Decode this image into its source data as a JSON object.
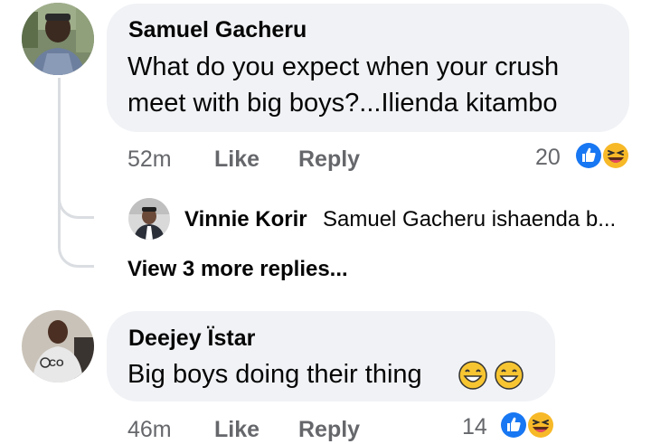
{
  "comments": [
    {
      "author": "Samuel Gacheru",
      "text_line1": "What do you expect when your crush",
      "text_line2": "meet with big boys?...Ilienda kitambo",
      "time": "52m",
      "like_label": "Like",
      "reply_label": "Reply",
      "reaction_count": "20",
      "reactions": [
        "like-icon",
        "laugh-icon"
      ]
    },
    {
      "author": "Deejey Ïstar",
      "text": "Big boys doing their thing",
      "emoji": [
        "grinning-emoji",
        "grinning-emoji"
      ],
      "time": "46m",
      "like_label": "Like",
      "reply_label": "Reply",
      "reaction_count": "14",
      "reactions": [
        "like-icon",
        "laugh-icon"
      ]
    }
  ],
  "reply_preview": {
    "author": "Vinnie Korir",
    "text": "Samuel Gacheru ishaenda b..."
  },
  "view_more_label": "View 3 more replies...",
  "colors": {
    "bubble": "#f0f2f5",
    "meta": "#65676b",
    "like_blue": "#1877f2",
    "laugh_yellow": "#f7b928",
    "thread_line": "#dadde1"
  }
}
